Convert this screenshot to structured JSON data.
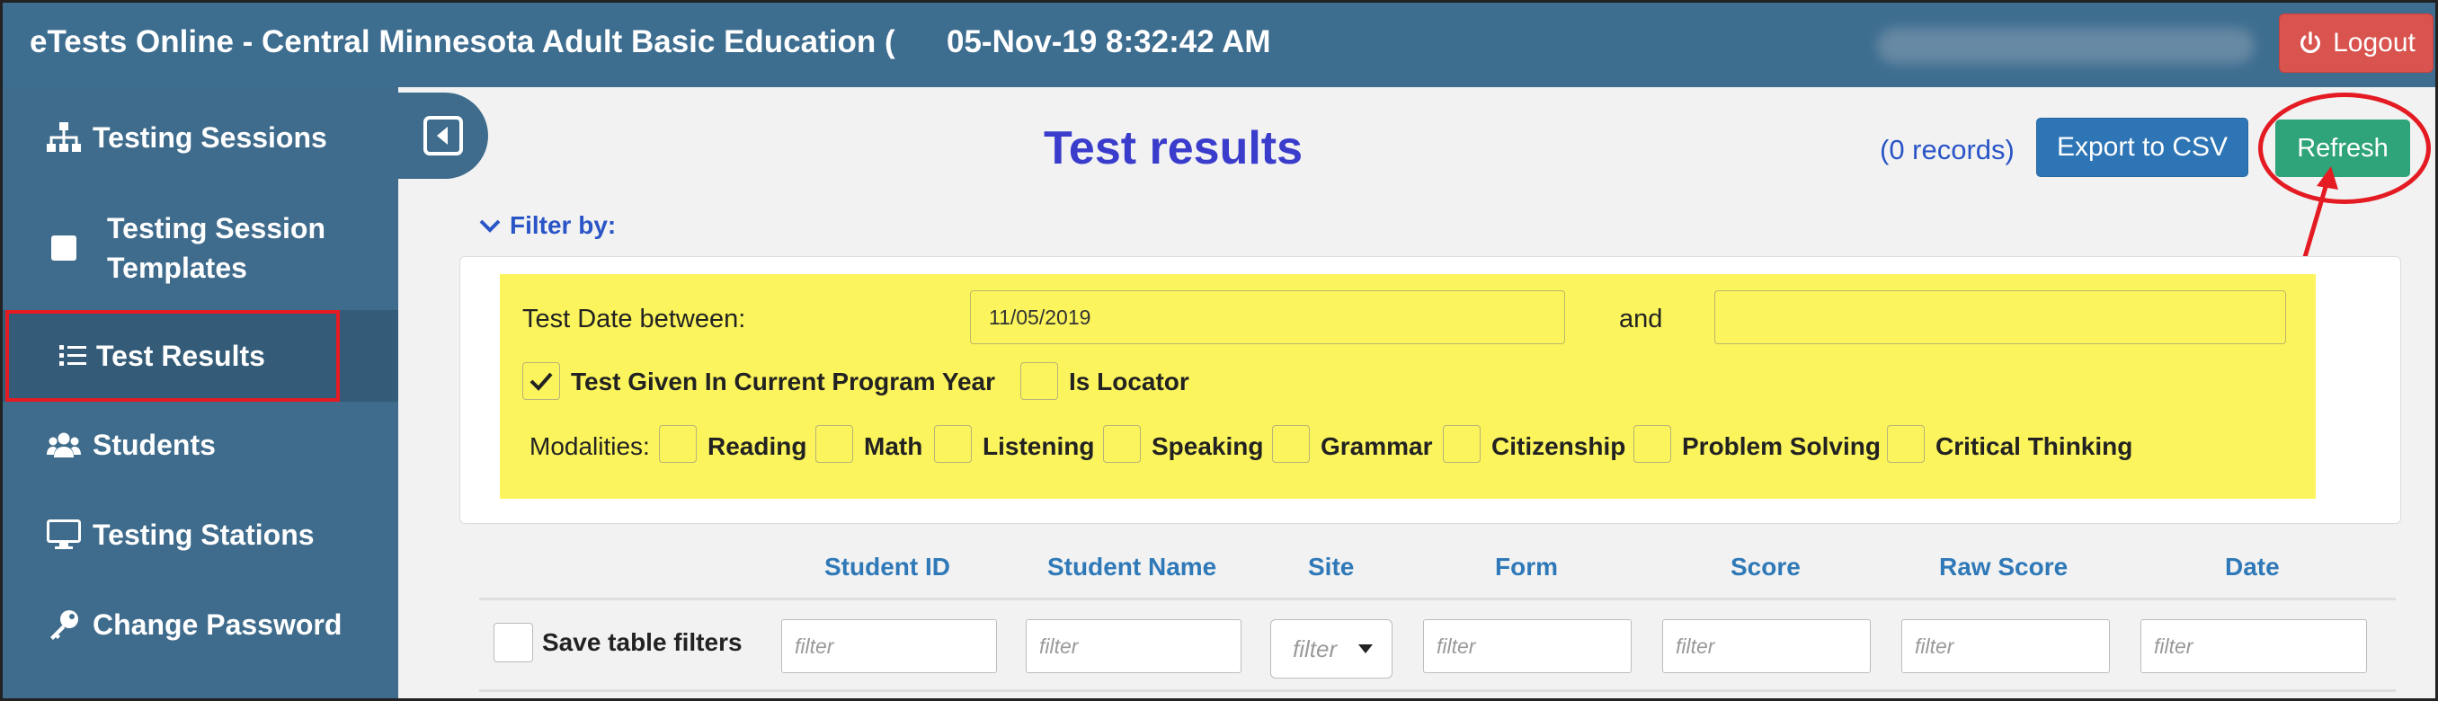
{
  "header": {
    "app_title": "eTests Online - Central Minnesota Adult Basic Education (",
    "datetime": "05-Nov-19 8:32:42 AM",
    "logout_label": "Logout"
  },
  "sidebar": {
    "items": [
      {
        "label": "Testing Sessions",
        "icon": "sitemap-icon"
      },
      {
        "label": "Testing Session Templates",
        "icon": "square-icon"
      },
      {
        "label": "Test Results",
        "icon": "list-icon",
        "active": true
      },
      {
        "label": "Students",
        "icon": "users-icon"
      },
      {
        "label": "Testing Stations",
        "icon": "monitor-icon"
      },
      {
        "label": "Change Password",
        "icon": "key-icon"
      }
    ]
  },
  "main": {
    "title": "Test results",
    "records": "(0 records)",
    "export_label": "Export to CSV",
    "refresh_label": "Refresh",
    "filter_toggle": "Filter by:"
  },
  "filters": {
    "date_label": "Test Date between:",
    "date_from": "11/05/2019",
    "and_label": "and",
    "date_to": "",
    "current_year_label": "Test Given In Current Program Year",
    "current_year_checked": true,
    "locator_label": "Is Locator",
    "locator_checked": false,
    "modalities_label": "Modalities:",
    "modalities": [
      "Reading",
      "Math",
      "Listening",
      "Speaking",
      "Grammar",
      "Citizenship",
      "Problem Solving",
      "Critical Thinking"
    ]
  },
  "table": {
    "columns": [
      "Student ID",
      "Student Name",
      "Site",
      "Form",
      "Score",
      "Raw Score",
      "Date"
    ],
    "save_filters_label": "Save table filters",
    "filter_placeholder": "filter"
  },
  "colors": {
    "header_bg": "#3d6d8f",
    "logout": "#d9534f",
    "export": "#2e75b6",
    "refresh": "#2fa47a",
    "highlight": "#fbf45c",
    "annotation": "#e41b23",
    "title": "#3a3ccc"
  }
}
